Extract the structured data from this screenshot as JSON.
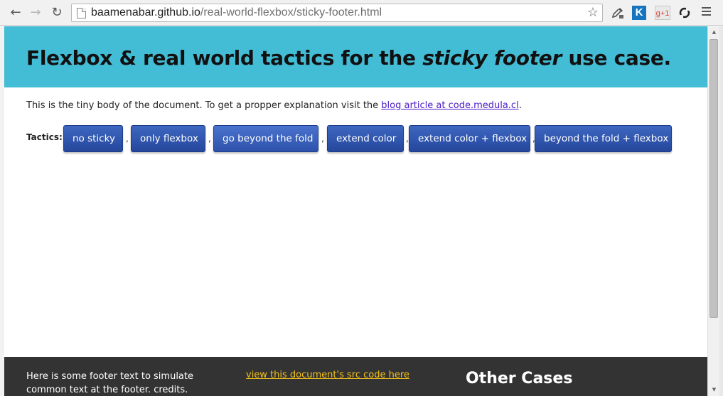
{
  "browser": {
    "back_icon": "←",
    "forward_icon": "→",
    "reload_icon": "↻",
    "url_host": "baamenabar.github.io",
    "url_path": "/real-world-flexbox/sticky-footer.html",
    "star_icon": "☆",
    "ext_k": "K",
    "ext_g": "g+1",
    "menu_icon": "≡"
  },
  "page": {
    "title_before": "Flexbox & real world tactics for the ",
    "title_em": "sticky footer",
    "title_after": " use case.",
    "intro_before": "This is the tiny body of the document. To get a propper explanation visit the ",
    "intro_link": "blog article at code.medula.cl",
    "intro_after": ".",
    "tactics_label": "Tactics:",
    "tactics": [
      "no sticky",
      "only flexbox",
      "go beyond the fold",
      "extend color",
      "extend color + flexbox",
      "beyond the fold + flexbox"
    ],
    "separator": ","
  },
  "footer": {
    "text": "Here is some footer text to simulate common text at the footer. credits.",
    "link": "view this document's src code here",
    "cases_title": "Other Cases"
  },
  "colors": {
    "header": "#43bcd5",
    "button": "#2f56b0",
    "footer": "#333333",
    "footer_link": "#f5c21b"
  }
}
